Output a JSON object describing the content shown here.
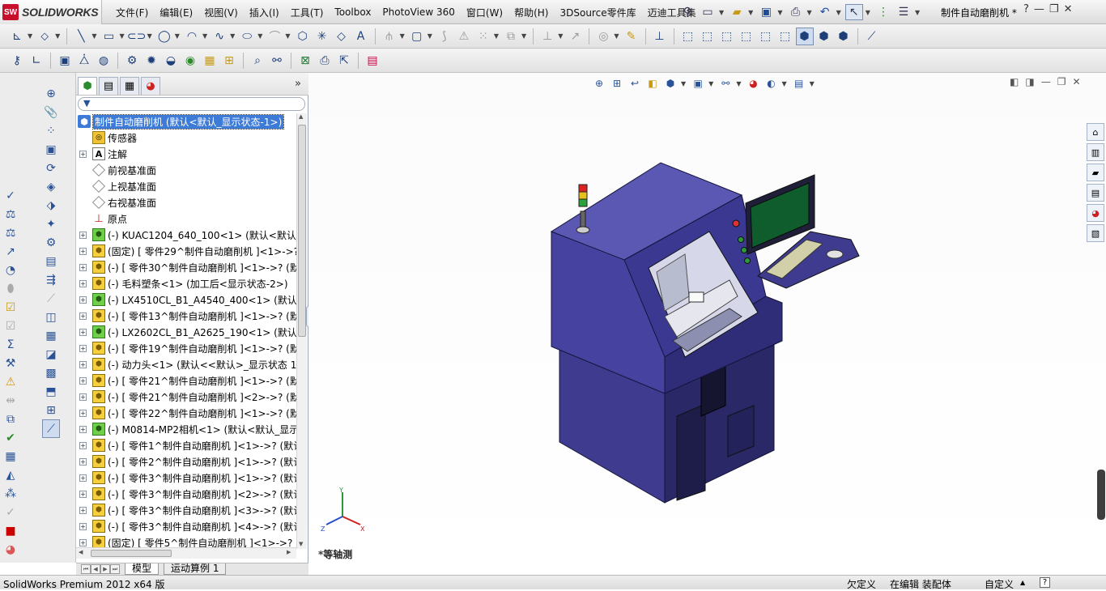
{
  "app": {
    "logo_text": "SOLIDWORKS",
    "logo_mark": "SW",
    "menu": [
      "文件(F)",
      "编辑(E)",
      "视图(V)",
      "插入(I)",
      "工具(T)",
      "Toolbox",
      "PhotoView 360",
      "窗口(W)",
      "帮助(H)",
      "3DSource零件库",
      "迈迪工具集"
    ],
    "document_title": "制件自动磨削机 *",
    "help": "?",
    "window_buttons": [
      "—",
      "❐",
      "✕"
    ]
  },
  "feature_manager": {
    "collapse_symbol": "»",
    "filter_icon": "▼",
    "root": "制件自动磨削机 (默认<默认_显示状态-1>)",
    "items": [
      {
        "icon": "sensor-icon",
        "label": "传感器",
        "expand": false
      },
      {
        "icon": "annotation-icon",
        "label": "注解",
        "expand": true
      },
      {
        "icon": "plane-icon",
        "label": "前视基准面",
        "expand": false
      },
      {
        "icon": "plane-icon",
        "label": "上视基准面",
        "expand": false
      },
      {
        "icon": "plane-icon",
        "label": "右视基准面",
        "expand": false
      },
      {
        "icon": "origin-icon",
        "label": "原点",
        "expand": false
      },
      {
        "icon": "part-green-icon",
        "label": "(-) KUAC1204_640_100<1> (默认<默认_显",
        "expand": true
      },
      {
        "icon": "part-icon",
        "label": "(固定) [ 零件29^制件自动磨削机 ]<1>->?",
        "expand": true
      },
      {
        "icon": "part-icon",
        "label": "(-) [ 零件30^制件自动磨削机 ]<1>->? (默",
        "expand": true
      },
      {
        "icon": "part-icon",
        "label": "(-) 毛料塑条<1> (加工后<显示状态-2>)",
        "expand": true
      },
      {
        "icon": "part-green-icon",
        "label": "(-) LX4510CL_B1_A4540_400<1> (默认<默",
        "expand": true
      },
      {
        "icon": "part-icon",
        "label": "(-) [ 零件13^制件自动磨削机 ]<1>->? (默",
        "expand": true
      },
      {
        "icon": "part-green-icon",
        "label": "(-) LX2602CL_B1_A2625_190<1> (默认<默",
        "expand": true
      },
      {
        "icon": "part-icon",
        "label": "(-) [ 零件19^制件自动磨削机 ]<1>->? (默",
        "expand": true
      },
      {
        "icon": "part-icon",
        "label": "(-) 动力头<1> (默认<<默认>_显示状态 1>",
        "expand": true
      },
      {
        "icon": "part-icon",
        "label": "(-) [ 零件21^制件自动磨削机 ]<1>->? (默",
        "expand": true
      },
      {
        "icon": "part-icon",
        "label": "(-) [ 零件21^制件自动磨削机 ]<2>->? (默",
        "expand": true
      },
      {
        "icon": "part-icon",
        "label": "(-) [ 零件22^制件自动磨削机 ]<1>->? (默",
        "expand": true
      },
      {
        "icon": "part-green-icon",
        "label": "(-) M0814-MP2相机<1> (默认<默认_显示",
        "expand": true
      },
      {
        "icon": "part-icon",
        "label": "(-) [ 零件1^制件自动磨削机 ]<1>->? (默认",
        "expand": true
      },
      {
        "icon": "part-icon",
        "label": "(-) [ 零件2^制件自动磨削机 ]<1>->? (默认",
        "expand": true
      },
      {
        "icon": "part-icon",
        "label": "(-) [ 零件3^制件自动磨削机 ]<1>->? (默认",
        "expand": true
      },
      {
        "icon": "part-icon",
        "label": "(-) [ 零件3^制件自动磨削机 ]<2>->? (默认",
        "expand": true
      },
      {
        "icon": "part-icon",
        "label": "(-) [ 零件3^制件自动磨削机 ]<3>->? (默认",
        "expand": true
      },
      {
        "icon": "part-icon",
        "label": "(-) [ 零件3^制件自动磨削机 ]<4>->? (默认",
        "expand": true
      },
      {
        "icon": "part-icon",
        "label": "(固定) [ 零件5^制件自动磨削机 ]<1>->? (",
        "expand": true
      }
    ]
  },
  "bottom_tabs": [
    "模型",
    "运动算例 1"
  ],
  "viewport": {
    "view_name": "*等轴测",
    "triad": {
      "x": "X",
      "y": "Y",
      "z": "Z"
    },
    "window_buttons": [
      "◧",
      "◨",
      "—",
      "❐",
      "✕"
    ]
  },
  "status": {
    "product": "SolidWorks Premium 2012 x64 版",
    "definition": "欠定义",
    "mode": "在编辑 装配体",
    "units": "自定义",
    "help": "?"
  },
  "colors": {
    "machine_body": "#3f3c8f",
    "machine_light": "#5a58b3",
    "machine_dark": "#2a2866",
    "selection": "#3d7bd9"
  }
}
